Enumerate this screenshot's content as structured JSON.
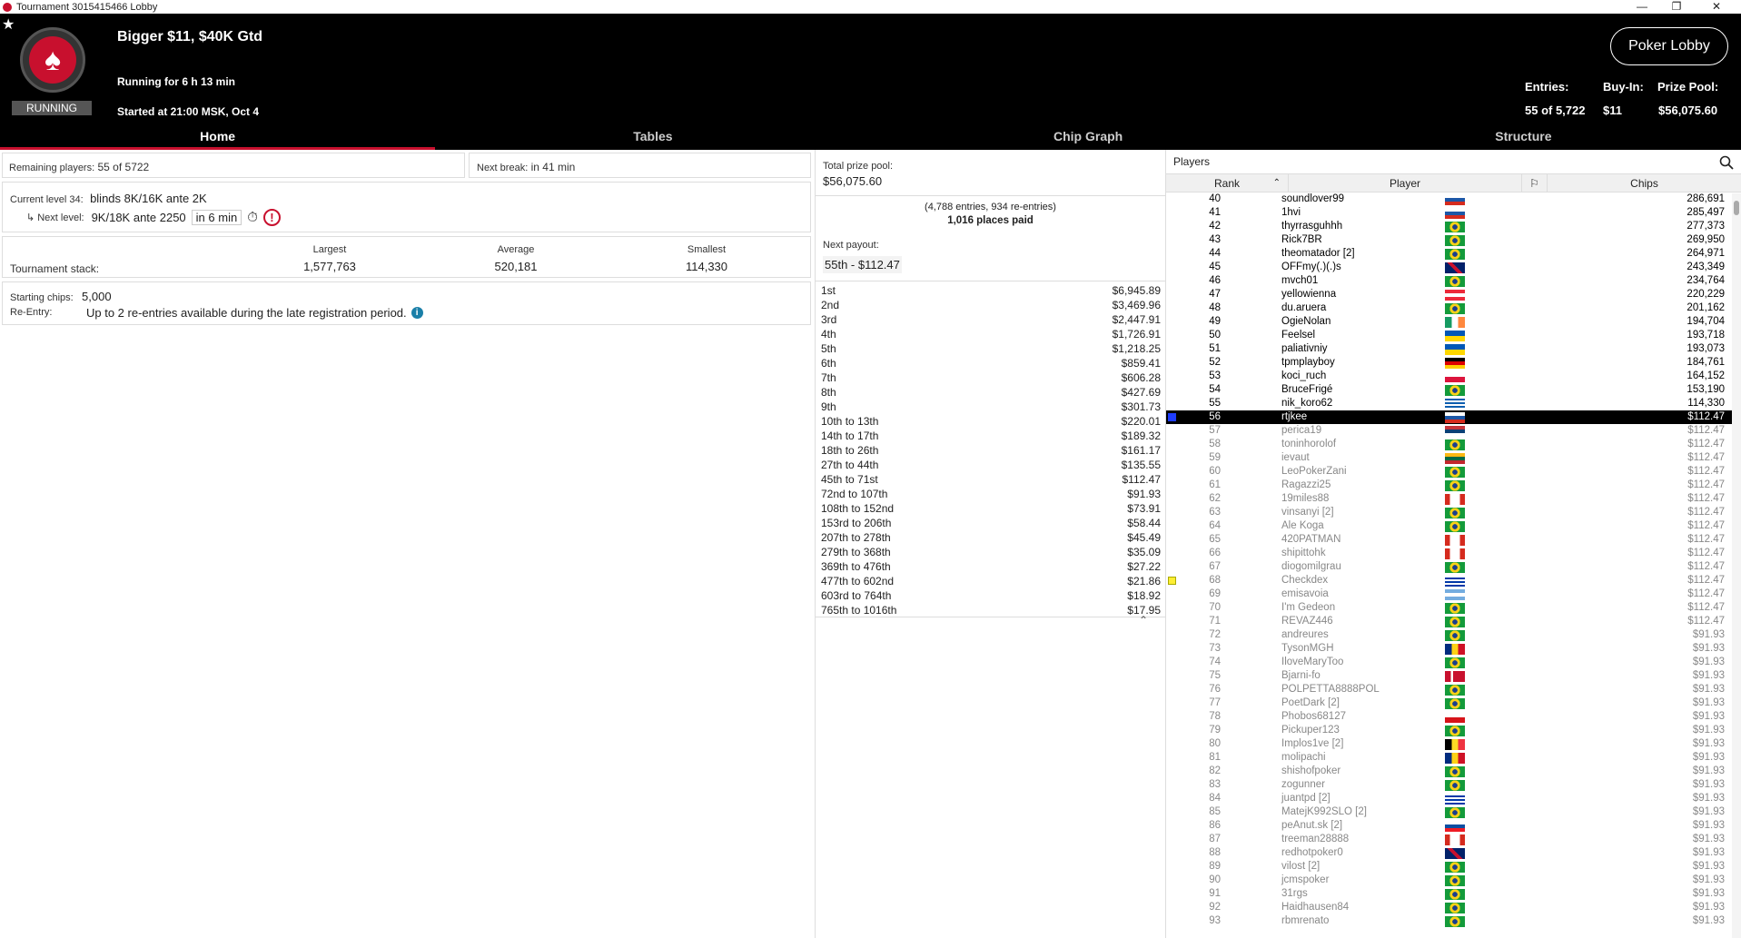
{
  "window": {
    "title": "Tournament 3015415466 Lobby"
  },
  "header": {
    "name": "Bigger $11, $40K Gtd",
    "running_for": "Running for 6 h 13 min",
    "started": "Started at 21:00 MSK, Oct 4",
    "status": "RUNNING",
    "lobby_button": "Poker Lobby",
    "entries_label": "Entries:",
    "entries_value": "55 of 5,722",
    "buyin_label": "Buy-In:",
    "buyin_value": "$11",
    "prizepool_label": "Prize Pool:",
    "prizepool_value": "$56,075.60"
  },
  "tabs": [
    "Home",
    "Tables",
    "Chip Graph",
    "Structure"
  ],
  "home": {
    "remaining_label": "Remaining players:",
    "remaining_value": "55 of 5722",
    "break_label": "Next break:",
    "break_value": "in 41 min",
    "level_label": "Current level 34:",
    "level_value": "blinds 8K/16K ante 2K",
    "next_label": "Next level:",
    "next_value": "9K/18K ante 2250",
    "next_time": "in 6 min",
    "stack_label": "Tournament stack:",
    "largest_label": "Largest",
    "largest_value": "1,577,763",
    "average_label": "Average",
    "average_value": "520,181",
    "smallest_label": "Smallest",
    "smallest_value": "114,330",
    "starting_label": "Starting chips:",
    "starting_value": "5,000",
    "reentry_label": "Re-Entry:",
    "reentry_value": "Up to 2 re-entries available during the late registration period."
  },
  "prizes": {
    "total_label": "Total prize pool:",
    "total_value": "$56,075.60",
    "entries_text": "(4,788 entries, 934 re-entries)",
    "paid_text": "1,016 places paid",
    "next_label": "Next payout:",
    "next_value": "55th - $112.47",
    "rows": [
      [
        "1st",
        "$6,945.89"
      ],
      [
        "2nd",
        "$3,469.96"
      ],
      [
        "3rd",
        "$2,447.91"
      ],
      [
        "4th",
        "$1,726.91"
      ],
      [
        "5th",
        "$1,218.25"
      ],
      [
        "6th",
        "$859.41"
      ],
      [
        "7th",
        "$606.28"
      ],
      [
        "8th",
        "$427.69"
      ],
      [
        "9th",
        "$301.73"
      ],
      [
        "10th to 13th",
        "$220.01"
      ],
      [
        "14th to 17th",
        "$189.32"
      ],
      [
        "18th to 26th",
        "$161.17"
      ],
      [
        "27th to 44th",
        "$135.55"
      ],
      [
        "45th to 71st",
        "$112.47"
      ],
      [
        "72nd to 107th",
        "$91.93"
      ],
      [
        "108th to 152nd",
        "$73.91"
      ],
      [
        "153rd to 206th",
        "$58.44"
      ],
      [
        "207th to 278th",
        "$45.49"
      ],
      [
        "279th to 368th",
        "$35.09"
      ],
      [
        "369th to 476th",
        "$27.22"
      ],
      [
        "477th to 602nd",
        "$21.86"
      ],
      [
        "603rd to 764th",
        "$18.92"
      ],
      [
        "765th to 1016th",
        "$17.95"
      ]
    ]
  },
  "players": {
    "title": "Players",
    "col_rank": "Rank",
    "col_player": "Player",
    "col_chips": "Chips",
    "rows": [
      [
        "40",
        "soundlover99",
        "$ru",
        "286,691",
        ""
      ],
      [
        "41",
        "1hvi",
        "$ru",
        "285,497",
        ""
      ],
      [
        "42",
        "thyrrasguhhh",
        "$br",
        "277,373",
        ""
      ],
      [
        "43",
        "Rick7BR",
        "$br",
        "269,950",
        ""
      ],
      [
        "44",
        "theomatador [2]",
        "$br",
        "264,971",
        ""
      ],
      [
        "45",
        "OFFmy(.)(.)s",
        "$uk",
        "243,349",
        ""
      ],
      [
        "46",
        "mvch01",
        "$br",
        "234,764",
        ""
      ],
      [
        "47",
        "yellowienna",
        "$at",
        "220,229",
        ""
      ],
      [
        "48",
        "du.aruera",
        "$br",
        "201,162",
        ""
      ],
      [
        "49",
        "OgieNolan",
        "$ie",
        "194,704",
        ""
      ],
      [
        "50",
        "Feelsel",
        "$ua",
        "193,718",
        ""
      ],
      [
        "51",
        "paliativniy",
        "$ua",
        "193,073",
        ""
      ],
      [
        "52",
        "tpmplayboy",
        "$de",
        "184,761",
        ""
      ],
      [
        "53",
        "koci_ruch",
        "$pl",
        "164,152",
        ""
      ],
      [
        "54",
        "BruceFrigé",
        "$br",
        "153,190",
        ""
      ],
      [
        "55",
        "nik_koro62",
        "$gr",
        "114,330",
        ""
      ],
      [
        "56",
        "rtjkee",
        "$ru",
        "$112.47",
        "me"
      ],
      [
        "57",
        "perica19",
        "$rs",
        "$112.47",
        "out"
      ],
      [
        "58",
        "toninhorolof",
        "$br",
        "$112.47",
        "out"
      ],
      [
        "59",
        "ievaut",
        "$lt",
        "$112.47",
        "out"
      ],
      [
        "60",
        "LeoPokerZani",
        "$br",
        "$112.47",
        "out"
      ],
      [
        "61",
        "Ragazzi25",
        "$br",
        "$112.47",
        "out"
      ],
      [
        "62",
        "19miles88",
        "$ca",
        "$112.47",
        "out"
      ],
      [
        "63",
        "vinsanyi [2]",
        "$br",
        "$112.47",
        "out"
      ],
      [
        "64",
        "Ale Koga",
        "$br",
        "$112.47",
        "out"
      ],
      [
        "65",
        "420PATMAN",
        "$ca",
        "$112.47",
        "out"
      ],
      [
        "66",
        "shipittohk",
        "$ca",
        "$112.47",
        "out"
      ],
      [
        "67",
        "diogomilgrau",
        "$br",
        "$112.47",
        "out"
      ],
      [
        "68",
        "Checkdex",
        "$uy",
        "$112.47",
        "out"
      ],
      [
        "69",
        "emisavoia",
        "$ar",
        "$112.47",
        "out"
      ],
      [
        "70",
        "I'm Gedeon",
        "$br",
        "$112.47",
        "out"
      ],
      [
        "71",
        "REVAZ446",
        "$br",
        "$112.47",
        "out"
      ],
      [
        "72",
        "andreures",
        "$br",
        "$91.93",
        "out"
      ],
      [
        "73",
        "TysonMGH",
        "$ro",
        "$91.93",
        "out"
      ],
      [
        "74",
        "IloveMaryToo",
        "$br",
        "$91.93",
        "out"
      ],
      [
        "75",
        "Bjarni-fo",
        "$dk",
        "$91.93",
        "out"
      ],
      [
        "76",
        "POLPETTA8888POL",
        "$br",
        "$91.93",
        "out"
      ],
      [
        "77",
        "PoetDark [2]",
        "$br",
        "$91.93",
        "out"
      ],
      [
        "78",
        "Phobos68127",
        "$cz",
        "$91.93",
        "out"
      ],
      [
        "79",
        "Pickuper123",
        "$br",
        "$91.93",
        "out"
      ],
      [
        "80",
        "Implos1ve [2]",
        "$be",
        "$91.93",
        "out"
      ],
      [
        "81",
        "molipachi",
        "$ro",
        "$91.93",
        "out"
      ],
      [
        "82",
        "shishofpoker",
        "$br",
        "$91.93",
        "out"
      ],
      [
        "83",
        "zogunner",
        "$br",
        "$91.93",
        "out"
      ],
      [
        "84",
        "juantpd [2]",
        "$uy",
        "$91.93",
        "out"
      ],
      [
        "85",
        "MatejK992SLO [2]",
        "$br",
        "$91.93",
        "out"
      ],
      [
        "86",
        "peAnut.sk [2]",
        "$sk",
        "$91.93",
        "out"
      ],
      [
        "87",
        "treeman28888",
        "$ca",
        "$91.93",
        "out"
      ],
      [
        "88",
        "redhotpoker0",
        "$uk",
        "$91.93",
        "out"
      ],
      [
        "89",
        "vilost [2]",
        "$br",
        "$91.93",
        "out"
      ],
      [
        "90",
        "jcmspoker",
        "$br",
        "$91.93",
        "out"
      ],
      [
        "91",
        "31rgs",
        "$br",
        "$91.93",
        "out"
      ],
      [
        "92",
        "Haidhausen84",
        "$br",
        "$91.93",
        "out"
      ],
      [
        "93",
        "rbmrenato",
        "$br",
        "$91.93",
        "out"
      ]
    ]
  }
}
